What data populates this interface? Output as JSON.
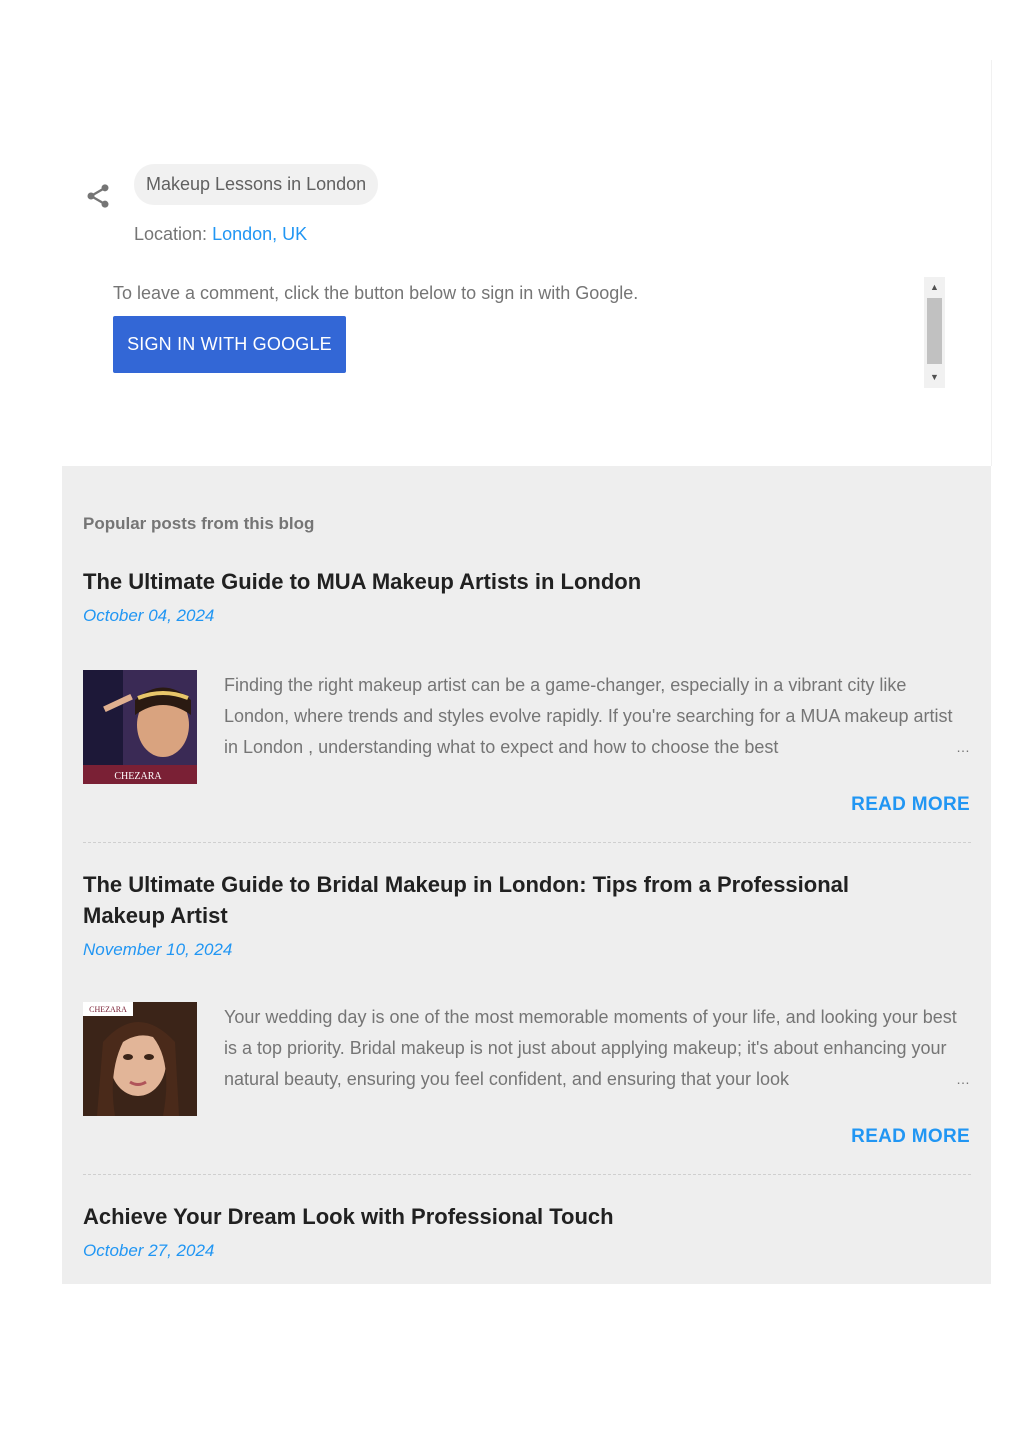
{
  "share": {
    "icon": "share-icon",
    "label": "Makeup Lessons in London"
  },
  "location": {
    "prefix": "Location: ",
    "value": "London, UK"
  },
  "comment": {
    "prompt": "To leave a comment, click the button below to sign in with Google.",
    "signin_button": "SIGN IN WITH GOOGLE"
  },
  "popular": {
    "heading": "Popular posts from this blog",
    "read_more": "READ MORE",
    "ellipsis": "…",
    "posts": [
      {
        "title": "The Ultimate Guide to MUA Makeup Artists in London",
        "date": "October 04, 2024",
        "snippet": "Finding the right makeup artist can be a game-changer, especially in a vibrant city like London, where trends and styles evolve rapidly. If you're searching for a MUA makeup artist in London , understanding what to expect and how to choose the best",
        "thumb_caption": "CHEZARA"
      },
      {
        "title": "The Ultimate Guide to Bridal Makeup in London: Tips from a Professional Makeup Artist",
        "date": "November 10, 2024",
        "snippet": "Your wedding day is one of the most memorable moments of your life, and looking your best is a top priority. Bridal makeup is not just about applying makeup; it's about enhancing your natural beauty, ensuring you feel confident, and ensuring that your look",
        "thumb_caption": "CHEZARA"
      },
      {
        "title": "Achieve Your Dream Look with Professional Touch",
        "date": "October 27, 2024"
      }
    ]
  }
}
